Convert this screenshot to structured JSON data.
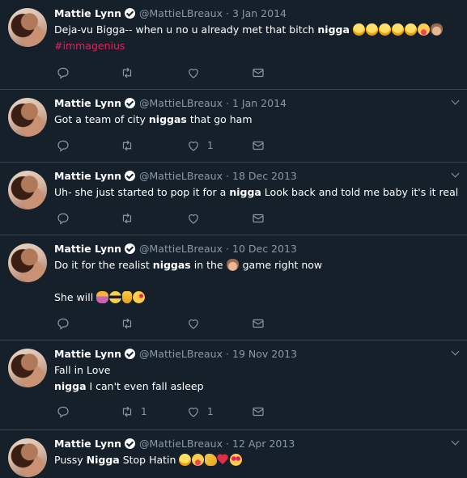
{
  "user": {
    "name": "Mattie Lynn",
    "handle": "@MattieLBreaux",
    "separator": "·"
  },
  "tweets": [
    {
      "date": "3 Jan 2014",
      "text_parts": [
        "Deja-vu Bigga-- when u no u already met that bitch ",
        "nigga",
        " "
      ],
      "emojis": [
        "face-with-tears-of-joy-icon",
        "face-with-tears-of-joy-icon",
        "face-with-tears-of-joy-icon",
        "face-with-tears-of-joy-icon",
        "face-with-tears-of-joy-icon",
        "face-with-tongue-icon",
        "see-no-evil-monkey-icon"
      ],
      "hashtag": "#immagenius",
      "reply_count": "",
      "retweet_count": "",
      "like_count": ""
    },
    {
      "date": "1 Jan 2014",
      "text_parts": [
        "Got a team of city ",
        "niggas",
        " that go ham"
      ],
      "reply_count": "",
      "retweet_count": "",
      "like_count": "1"
    },
    {
      "date": "18 Dec 2013",
      "text_parts": [
        "Uh- she just started to pop it for a ",
        "nigga",
        " Look back and told me baby it's it real"
      ],
      "reply_count": "",
      "retweet_count": "",
      "like_count": ""
    },
    {
      "date": "10 Dec 2013",
      "text_parts": [
        "Do it for the realist ",
        "niggas",
        " in the ",
        " game right now"
      ],
      "line2": "She will",
      "reply_count": "",
      "retweet_count": "",
      "like_count": ""
    },
    {
      "date": "19 Nov 2013",
      "line1": "Fall in Love",
      "text_parts": [
        "nigga",
        " I can't even fall asleep"
      ],
      "reply_count": "",
      "retweet_count": "1",
      "like_count": "1"
    },
    {
      "date": "12 Apr 2013",
      "text_parts": [
        "Pussy ",
        "Nigga",
        " Stop Hatin "
      ],
      "reply_count": "",
      "retweet_count": "",
      "like_count": ""
    }
  ]
}
